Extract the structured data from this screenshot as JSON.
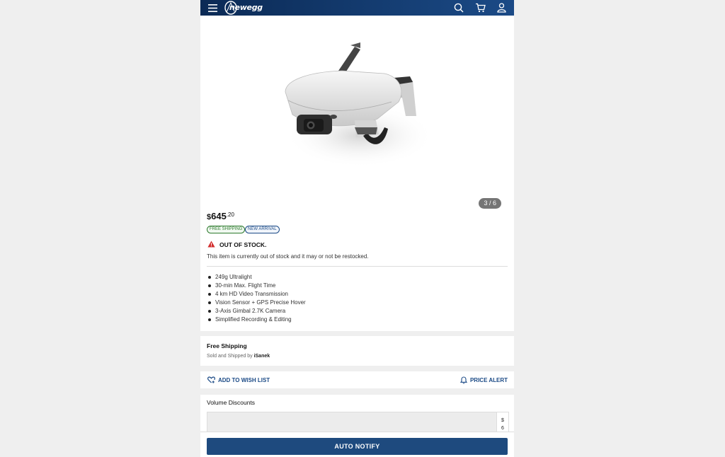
{
  "header": {
    "logo_text": "newegg",
    "icons": [
      "menu-icon",
      "search-icon",
      "cart-icon",
      "account-icon"
    ]
  },
  "product": {
    "image_counter": "3 / 6",
    "price": {
      "currency": "$",
      "dollars": "645",
      "cents": ".20"
    },
    "badges": {
      "shipping": "FREE SHIPPING",
      "new": "NEW ARRIVAL"
    },
    "stock": {
      "title": "OUT OF STOCK.",
      "message": "This item is currently out of stock and it may or not be restocked."
    },
    "features": [
      "249g Ultralight",
      "30-min Max. Flight Time",
      "4 km HD Video Transmission",
      "Vision Sensor + GPS Precise Hover",
      "3-Axis Gimbal 2.7K Camera",
      "Simplified Recording & Editing"
    ]
  },
  "shipping": {
    "title": "Free Shipping",
    "sold_by_prefix": "Sold and Shipped by",
    "seller": "iSanek"
  },
  "actions": {
    "wish_list": "ADD TO WISH LIST",
    "price_alert": "PRICE ALERT"
  },
  "volume": {
    "title": "Volume Discounts",
    "cell_line1": "$",
    "cell_line2": "6"
  },
  "cta": {
    "label": "AUTO NOTIFY"
  },
  "colors": {
    "header_bg": "#0b2a55",
    "accent": "#1b4a86",
    "button_bg": "#1e4a7e",
    "warning": "#d32f2f",
    "badge_green": "#2d7a2d"
  }
}
